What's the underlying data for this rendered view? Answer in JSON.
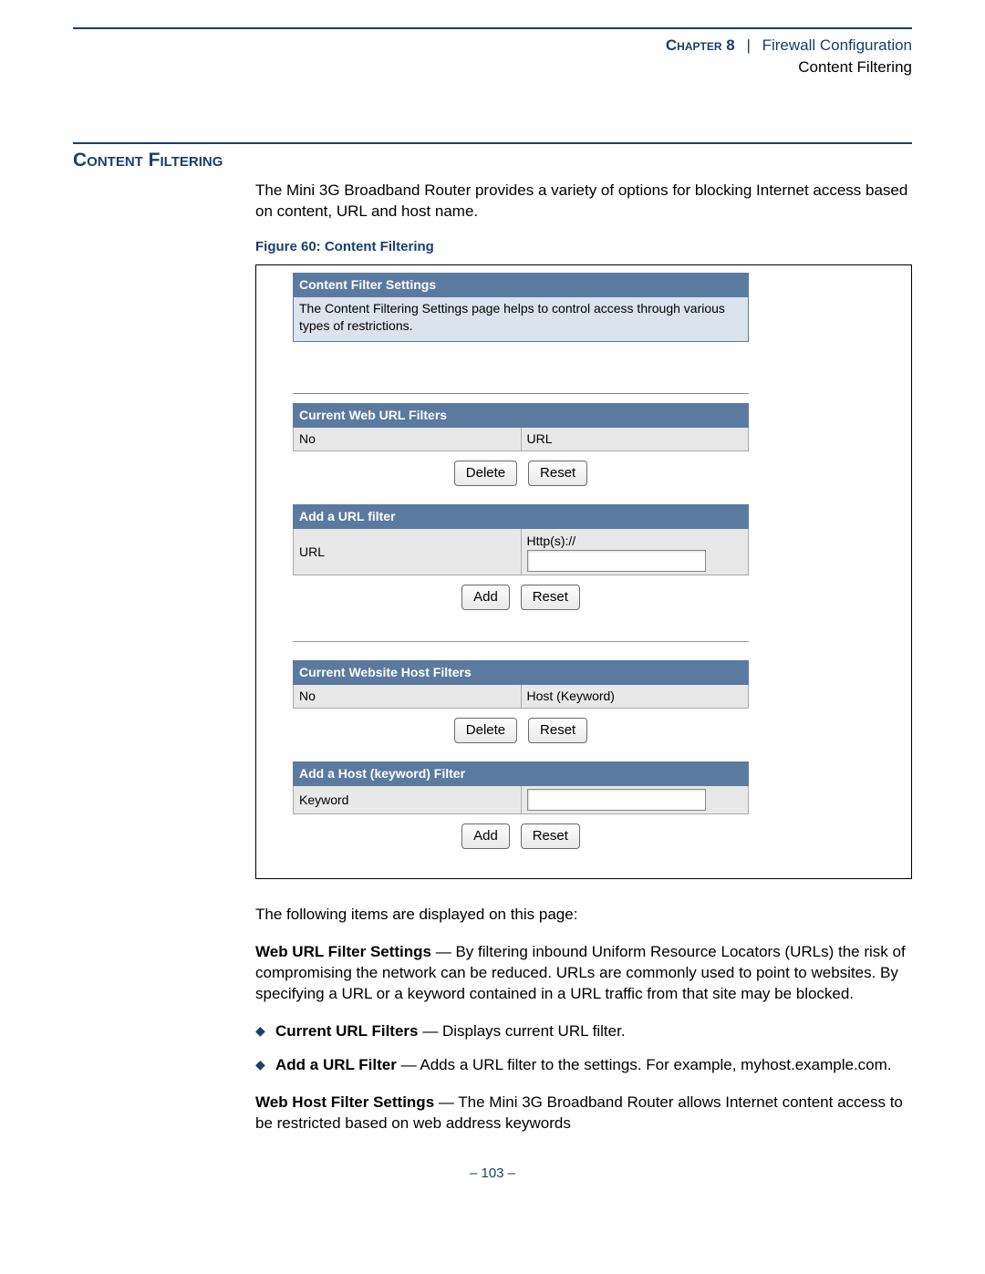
{
  "header": {
    "chapter_label": "Chapter",
    "chapter_number": "8",
    "separator": "|",
    "chapter_title": "Firewall Configuration",
    "sub_title": "Content Filtering"
  },
  "section_title": "Content Filtering",
  "intro_paragraph": "The Mini 3G Broadband Router provides a variety of options for blocking Internet access based on content, URL and host name.",
  "figure_caption": "Figure 60:  Content Filtering",
  "screenshot": {
    "settings_header": "Content Filter Settings",
    "settings_desc": "The Content Filtering Settings page helps to control access through various types of restrictions.",
    "url_filters": {
      "title": "Current Web URL Filters",
      "col_no": "No",
      "col_url": "URL",
      "btn_delete": "Delete",
      "btn_reset": "Reset"
    },
    "add_url": {
      "title": "Add a URL filter",
      "label": "URL",
      "prefix": "Http(s)://",
      "btn_add": "Add",
      "btn_reset": "Reset"
    },
    "host_filters": {
      "title": "Current Website Host Filters",
      "col_no": "No",
      "col_host": "Host (Keyword)",
      "btn_delete": "Delete",
      "btn_reset": "Reset"
    },
    "add_host": {
      "title": "Add a Host (keyword) Filter",
      "label": "Keyword",
      "btn_add": "Add",
      "btn_reset": "Reset"
    }
  },
  "following_items_text": "The following items are displayed on this page:",
  "web_url_filter": {
    "label": "Web URL Filter Settings",
    "text": " — By filtering inbound Uniform Resource Locators (URLs) the risk of compromising the network can be reduced. URLs are commonly used to point to websites. By specifying a URL or a keyword contained in a URL traffic from that site may be blocked."
  },
  "bullets": {
    "current": {
      "label": "Current URL Filters",
      "text": " — Displays current URL filter."
    },
    "add": {
      "label": "Add a URL Filter",
      "text": " — Adds a URL filter to the settings. For example, myhost.example.com."
    }
  },
  "web_host_filter": {
    "label": "Web Host Filter Settings",
    "text": " — The Mini 3G Broadband Router allows Internet content access to be restricted based on web address keywords"
  },
  "page_number": "–  103  –"
}
